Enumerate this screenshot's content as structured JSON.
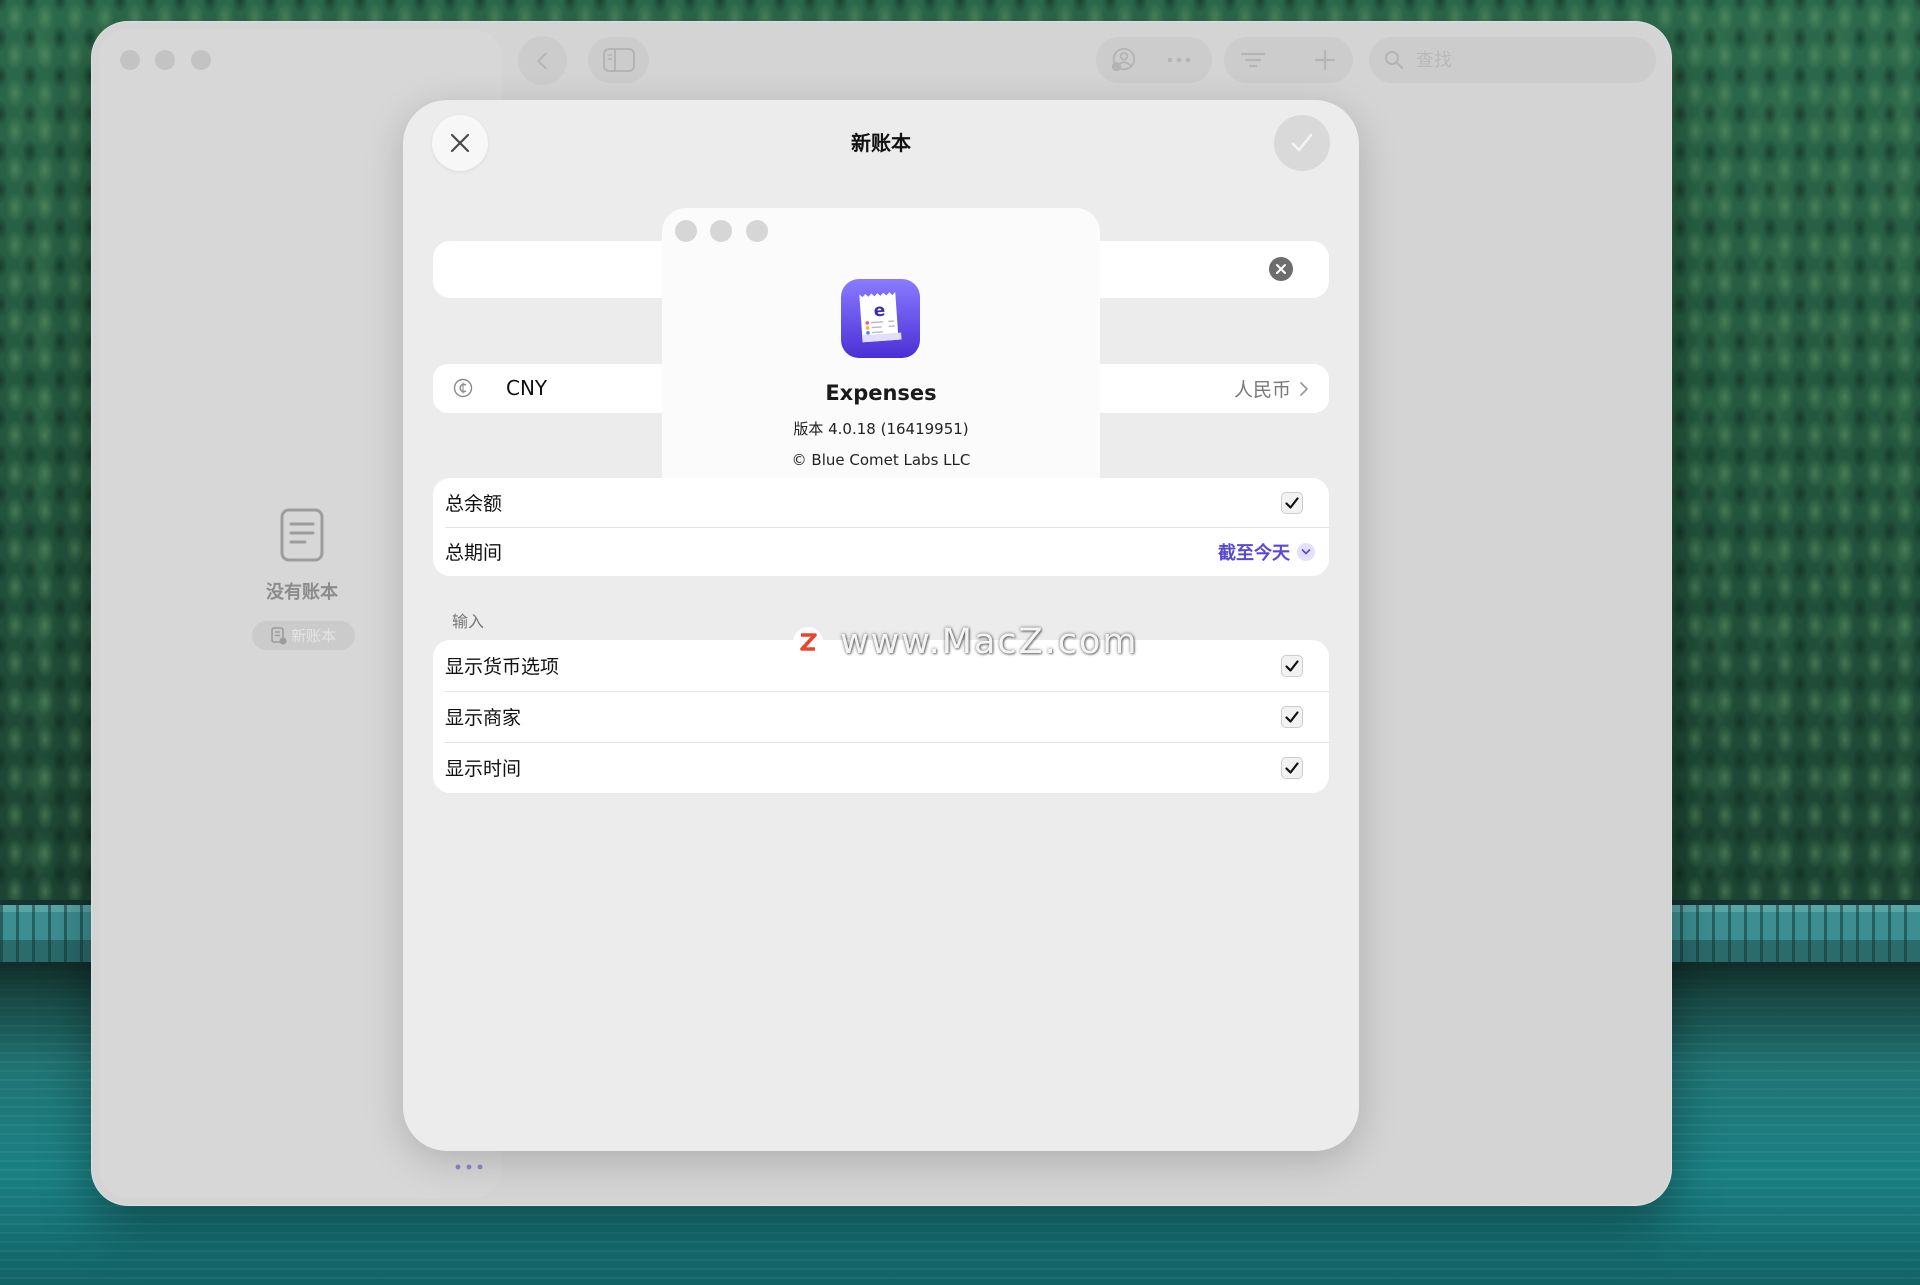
{
  "toolbar": {
    "search": {
      "placeholder": "查找",
      "value": ""
    }
  },
  "sidebar": {
    "empty_state": {
      "title": "没有账本",
      "new_button_label": "新账本"
    }
  },
  "sheet": {
    "title": "新账本",
    "name_field": {
      "value": ""
    },
    "currency": {
      "code": "CNY",
      "name": "人民币"
    },
    "summary": [
      {
        "label": "总余额",
        "checked": true
      },
      {
        "label": "总期间",
        "value": "截至今天"
      }
    ],
    "input_section": {
      "header": "输入",
      "rows": [
        {
          "label": "显示货币选项",
          "checked": true
        },
        {
          "label": "显示商家",
          "checked": true
        },
        {
          "label": "显示时间",
          "checked": true
        }
      ]
    }
  },
  "about_panel": {
    "app_name": "Expenses",
    "version": "版本 4.0.18 (16419951)",
    "copyright": "© Blue Comet Labs LLC"
  },
  "watermark": {
    "text": "www.MacZ.com"
  },
  "colors": {
    "accent": "#5a4ad1",
    "window_background": "#d4d4d4",
    "sheet_background": "#ececec",
    "app_icon_top": "#8a7bff",
    "app_icon_bottom": "#4b2fd6"
  },
  "icons": {
    "close": "close-icon",
    "confirm": "checkmark-icon",
    "clear": "clear-icon",
    "currency": "currency-icon",
    "disclosure": "chevron-right-icon",
    "popup": "chevron-down-icon",
    "empty_state": "document-icon",
    "back": "chevron-left-icon",
    "sidebar_toggle": "sidebar-toggle-icon",
    "collaborate": "person-icon",
    "more": "ellipsis-icon",
    "sort": "filter-icon",
    "add": "plus-icon",
    "search": "search-icon"
  }
}
